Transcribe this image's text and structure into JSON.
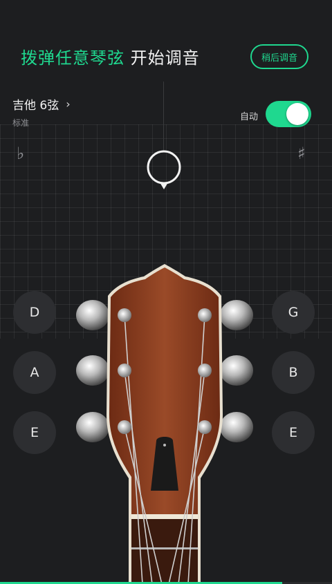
{
  "header": {
    "title_accent": "拨弹任意琴弦",
    "title_rest": " 开始调音",
    "later_label": "稍后调音"
  },
  "tuning": {
    "name": "吉他 6弦",
    "subtitle": "标准"
  },
  "auto_mode": {
    "label": "自动",
    "enabled": true
  },
  "symbols": {
    "flat": "♭",
    "sharp": "♯"
  },
  "strings_left": [
    {
      "note": "D"
    },
    {
      "note": "A"
    },
    {
      "note": "E"
    }
  ],
  "strings_right": [
    {
      "note": "G"
    },
    {
      "note": "B"
    },
    {
      "note": "E"
    }
  ],
  "colors": {
    "accent": "#1fd88f",
    "background": "#1d1e20",
    "button": "#2d2e31",
    "wood": "#8a3e22"
  },
  "progress_fraction": 0.85
}
